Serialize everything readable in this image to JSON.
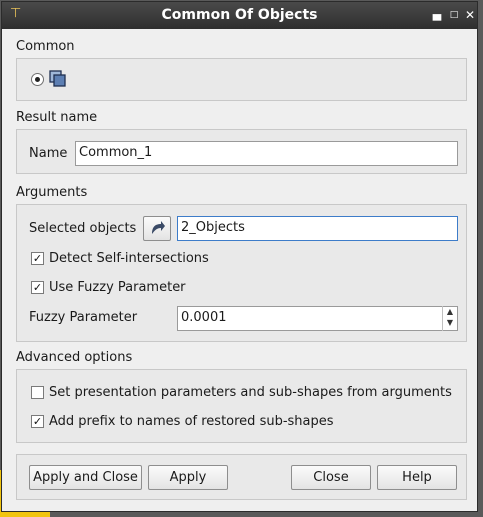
{
  "window": {
    "title": "Common Of Objects"
  },
  "common": {
    "label": "Common"
  },
  "result": {
    "section_label": "Result name",
    "name_label": "Name",
    "name_value": "Common_1"
  },
  "arguments": {
    "section_label": "Arguments",
    "selected_label": "Selected objects",
    "selected_value": "2_Objects",
    "detect_label": "Detect Self-intersections",
    "detect_checked": true,
    "fuzzy_toggle_label": "Use Fuzzy Parameter",
    "fuzzy_toggle_checked": true,
    "fuzzy_label": "Fuzzy Parameter",
    "fuzzy_value": "0.0001"
  },
  "advanced": {
    "section_label": "Advanced options",
    "presentation_label": "Set presentation parameters and sub-shapes from arguments",
    "presentation_checked": false,
    "prefix_label": "Add prefix to names of restored sub-shapes",
    "prefix_checked": true
  },
  "buttons": {
    "apply_close": "Apply and Close",
    "apply": "Apply",
    "close": "Close",
    "help": "Help"
  }
}
